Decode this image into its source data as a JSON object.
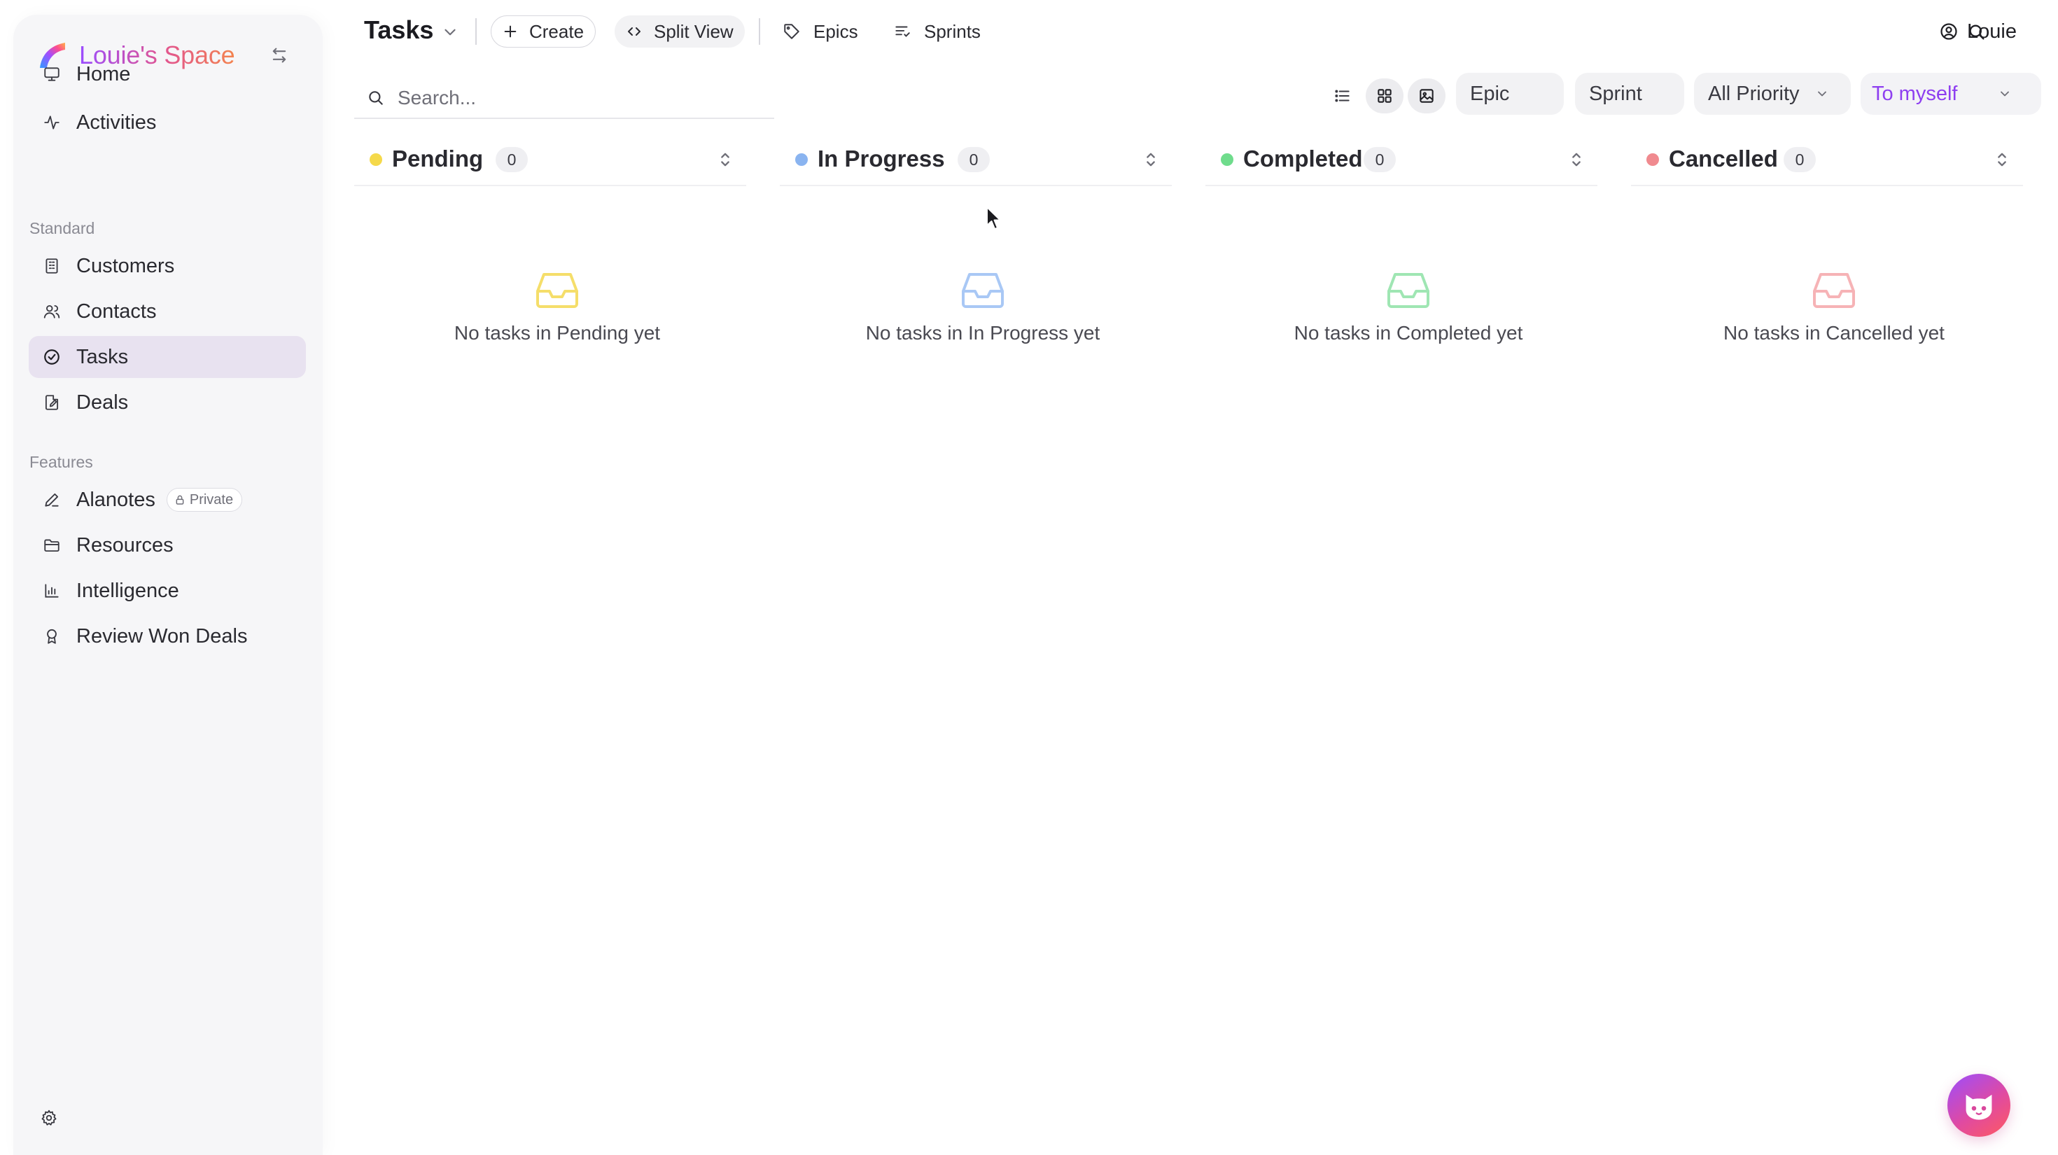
{
  "brand": {
    "name": "Louie's Space",
    "accent": "#9a4dff"
  },
  "sidebar": {
    "primary": [
      {
        "label": "Home",
        "icon": "monitor-icon"
      },
      {
        "label": "Activities",
        "icon": "activity-icon"
      }
    ],
    "standard_label": "Standard",
    "standard": [
      {
        "label": "Customers",
        "icon": "building-icon"
      },
      {
        "label": "Contacts",
        "icon": "users-icon"
      },
      {
        "label": "Tasks",
        "icon": "check-circle-icon",
        "active": true
      },
      {
        "label": "Deals",
        "icon": "document-edit-icon"
      }
    ],
    "features_label": "Features",
    "features": [
      {
        "label": "Alanotes",
        "icon": "pen-icon",
        "badge": "Private"
      },
      {
        "label": "Resources",
        "icon": "folder-icon"
      },
      {
        "label": "Intelligence",
        "icon": "bar-chart-icon"
      },
      {
        "label": "Review Won Deals",
        "icon": "award-icon"
      }
    ]
  },
  "header": {
    "title": "Tasks",
    "create_label": "Create",
    "split_view_label": "Split View",
    "epics_label": "Epics",
    "sprints_label": "Sprints",
    "user_name": "Louie"
  },
  "filters": {
    "search_placeholder": "Search...",
    "view_modes": [
      "list",
      "board",
      "gallery"
    ],
    "active_view": "board",
    "epic_label": "Epic",
    "sprint_label": "Sprint",
    "priority_label": "All Priority",
    "assignee_label": "To myself"
  },
  "columns": [
    {
      "title": "Pending",
      "count": "0",
      "color": "#f5d94a",
      "empty_text": "No tasks in Pending yet"
    },
    {
      "title": "In Progress",
      "count": "0",
      "color": "#8ab4f0",
      "empty_text": "No tasks in In Progress yet"
    },
    {
      "title": "Completed",
      "count": "0",
      "color": "#6fdc8c",
      "empty_text": "No tasks in Completed yet"
    },
    {
      "title": "Cancelled",
      "count": "0",
      "color": "#f08a8f",
      "empty_text": "No tasks in Cancelled yet"
    }
  ]
}
